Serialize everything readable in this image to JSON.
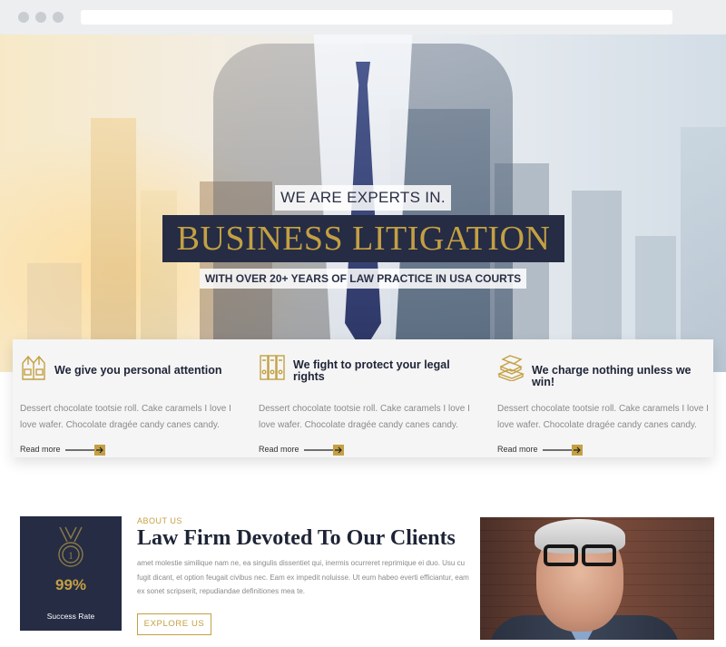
{
  "hero": {
    "kicker": "WE ARE EXPERTS IN.",
    "title": "BUSINESS LITIGATION",
    "subtitle": "WITH OVER 20+ YEARS OF LAW PRACTICE IN USA COURTS"
  },
  "features": [
    {
      "icon": "vest-icon",
      "title": "We give you personal attention",
      "text": "Dessert chocolate tootsie roll. Cake caramels I love I love wafer. Chocolate dragée candy canes candy.",
      "link": "Read more"
    },
    {
      "icon": "binders-icon",
      "title": "We fight to protect your legal rights",
      "text": "Dessert chocolate tootsie roll. Cake caramels I love I love wafer. Chocolate dragée candy canes candy.",
      "link": "Read more"
    },
    {
      "icon": "books-icon",
      "title": "We charge nothing unless we win!",
      "text": "Dessert chocolate tootsie roll. Cake caramels I love I love wafer. Chocolate dragée candy canes candy.",
      "link": "Read more"
    }
  ],
  "stat": {
    "icon": "medal-icon",
    "medal_number": "1",
    "value": "99%",
    "label": "Success Rate"
  },
  "about": {
    "kicker": "ABOUT US",
    "title": "Law Firm Devoted To Our Clients",
    "text": "amet molestie similique nam ne, ea singulis dissentiet qui, inermis ocurreret reprimique ei duo. Usu cu fugit dicant, et option feugait civibus nec. Eam ex impedit noluisse. Ut eum habeo everti efficiantur, eam ex sonet scripserit, repudiandae definitiones mea te.",
    "button": "EXPLORE US"
  },
  "colors": {
    "navy": "#252c44",
    "gold": "#c4a043",
    "muted_text": "#8a8a8a"
  }
}
